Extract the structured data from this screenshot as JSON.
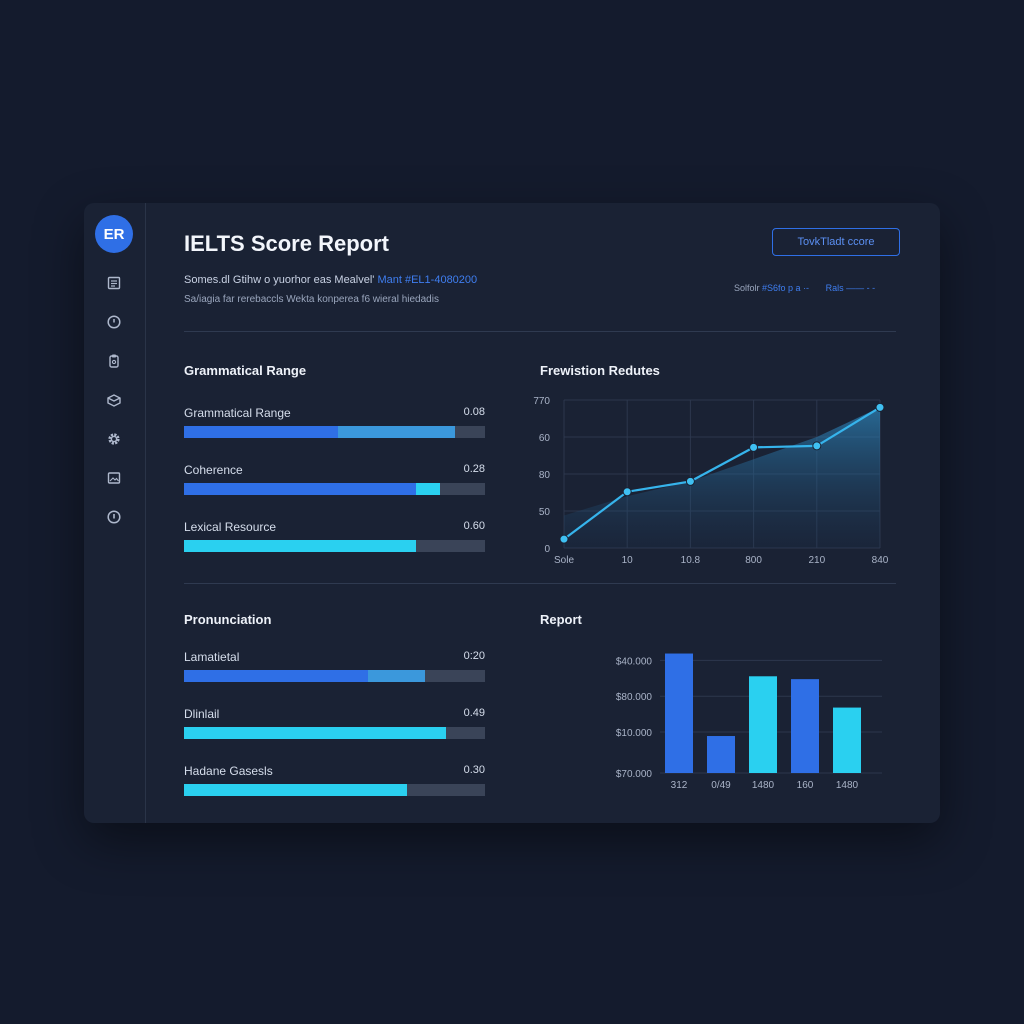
{
  "sidebar": {
    "avatar_initials": "ER",
    "icons": [
      "document-icon",
      "clock-icon",
      "clipboard-icon",
      "layers-icon",
      "gear-icon",
      "image-icon",
      "info-icon"
    ]
  },
  "header": {
    "title": "IELTS Score Report",
    "meta_line1": "Somes.dl Gtihw o yuorhor eas Mealvel'",
    "meta_line1_accent": "Mant #EL1-4080200",
    "meta_line2": "Sa/iagia far rerebaccls Wekta konperea f6 wieral hiedadis",
    "button_label": "TovkTladt ccore",
    "meta_right_a": "Solfolr",
    "meta_right_b": "#S6fo p a  ·-",
    "meta_right_c": "Rals  ——  - -"
  },
  "sections": {
    "left_top_title": "Grammatical Range",
    "left_bottom_title": "Pronunciation",
    "right_top_title": "Frewistion Redutes",
    "right_bottom_title": "Report"
  },
  "left_top_bars": [
    {
      "label": "Grammatical Range",
      "value": "0.08",
      "primary": 0.51,
      "secondary": 0.9
    },
    {
      "label": "Coherence",
      "value": "0.28",
      "primary": 0.77,
      "secondary": 0.85
    },
    {
      "label": "Lexical Resource",
      "value": "0.60",
      "primary": 0.77,
      "secondary": 0.77
    }
  ],
  "left_bottom_bars": [
    {
      "label": "Lamatietal",
      "value": "0:20",
      "primary": 0.61,
      "secondary": 0.8
    },
    {
      "label": "Dlinlail",
      "value": "0.49",
      "primary": 0.87,
      "secondary": 0.87
    },
    {
      "label": "Hadane Gasesls",
      "value": "0.30",
      "primary": 0.74,
      "secondary": 0.74
    }
  ],
  "colors": {
    "primary_blue": "#2f6fe6",
    "secondary_blue": "#3b98dc",
    "cyan": "#2ad0f0",
    "track": "#3a4458"
  },
  "chart_data": [
    {
      "type": "line",
      "title": "Frewistion Redutes",
      "x_tick_labels": [
        "Sole",
        "10",
        "10.8",
        "800",
        "210",
        "840"
      ],
      "y_tick_labels": [
        "0",
        "50",
        "80",
        "60",
        "770"
      ],
      "x": [
        0,
        1,
        2,
        3,
        4,
        5
      ],
      "y": [
        6,
        38,
        45,
        68,
        69,
        95
      ],
      "area_upper": [
        22,
        35,
        45,
        60,
        75,
        95
      ],
      "ylim": [
        0,
        100
      ],
      "grid": true
    },
    {
      "type": "bar",
      "title": "Report",
      "categories": [
        "312",
        "0/49",
        "1480",
        "160",
        "1480"
      ],
      "values": [
        42,
        13,
        34,
        33,
        23
      ],
      "bar_colors": [
        "#2f6fe6",
        "#2f6fe6",
        "#2ad0f0",
        "#2f6fe6",
        "#2ad0f0"
      ],
      "y_tick_labels": [
        "$70.000",
        "$10.000",
        "$80.000",
        "$40.000"
      ],
      "ylim": [
        0,
        45
      ],
      "grid": true
    }
  ]
}
